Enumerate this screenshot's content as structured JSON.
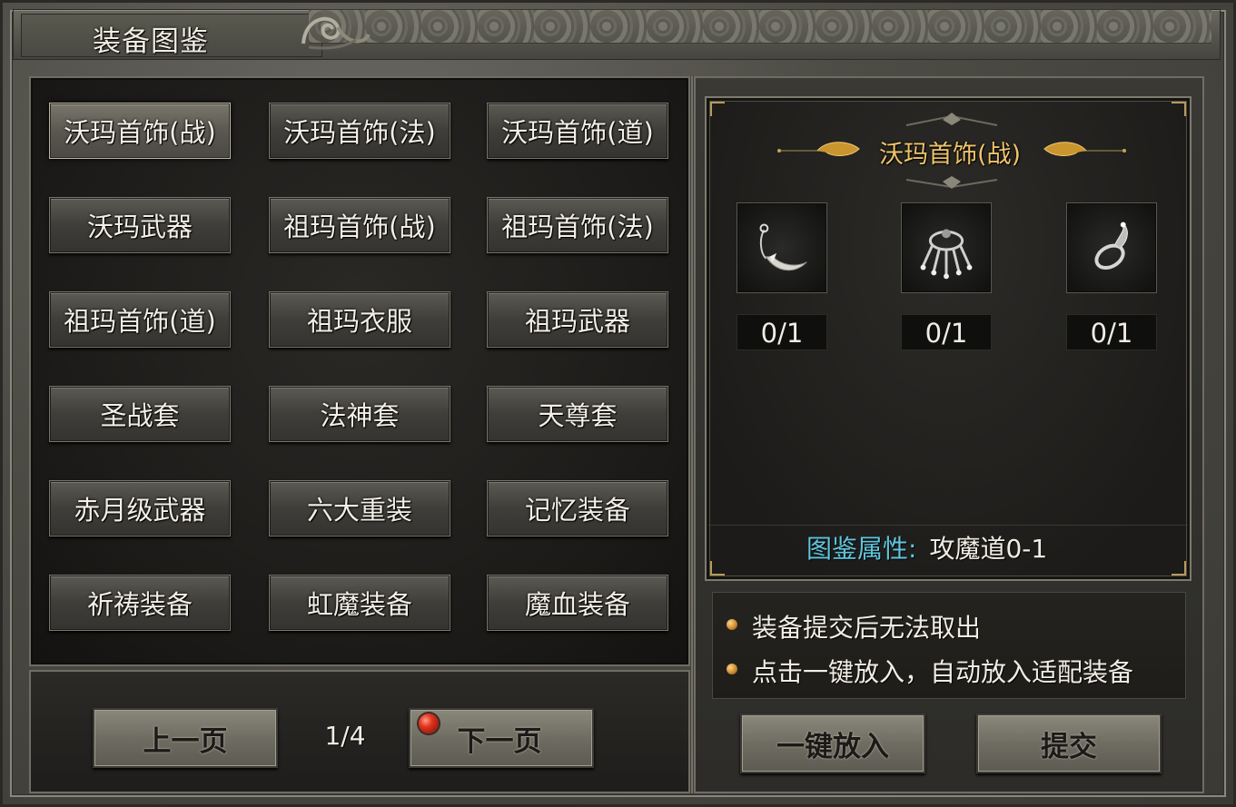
{
  "window": {
    "title": "装备图鉴"
  },
  "categories": [
    {
      "label": "沃玛首饰(战)",
      "active": true
    },
    {
      "label": "沃玛首饰(法)",
      "active": false
    },
    {
      "label": "沃玛首饰(道)",
      "active": false
    },
    {
      "label": "沃玛武器",
      "active": false
    },
    {
      "label": "祖玛首饰(战)",
      "active": false
    },
    {
      "label": "祖玛首饰(法)",
      "active": false
    },
    {
      "label": "祖玛首饰(道)",
      "active": false
    },
    {
      "label": "祖玛衣服",
      "active": false
    },
    {
      "label": "祖玛武器",
      "active": false
    },
    {
      "label": "圣战套",
      "active": false
    },
    {
      "label": "法神套",
      "active": false
    },
    {
      "label": "天尊套",
      "active": false
    },
    {
      "label": "赤月级武器",
      "active": false
    },
    {
      "label": "六大重装",
      "active": false
    },
    {
      "label": "记忆装备",
      "active": false
    },
    {
      "label": "祈祷装备",
      "active": false
    },
    {
      "label": "虹魔装备",
      "active": false
    },
    {
      "label": "魔血装备",
      "active": false
    }
  ],
  "pagination": {
    "prev_label": "上一页",
    "page_text": "1/4",
    "next_label": "下一页"
  },
  "detail": {
    "title": "沃玛首饰(战)",
    "items": [
      {
        "icon": "necklace-icon",
        "count": "0/1"
      },
      {
        "icon": "bracelet-icon",
        "count": "0/1"
      },
      {
        "icon": "ring-icon",
        "count": "0/1"
      }
    ],
    "attribute_label": "图鉴属性:",
    "attribute_value": "攻魔道0-1"
  },
  "notes": [
    "装备提交后无法取出",
    "点击一键放入，自动放入适配装备"
  ],
  "actions": {
    "auto_place_label": "一键放入",
    "submit_label": "提交"
  },
  "colors": {
    "title_gold": "#f0c46a",
    "attribute_cyan": "#5fc6de",
    "next_indicator_red": "#e2341d"
  }
}
